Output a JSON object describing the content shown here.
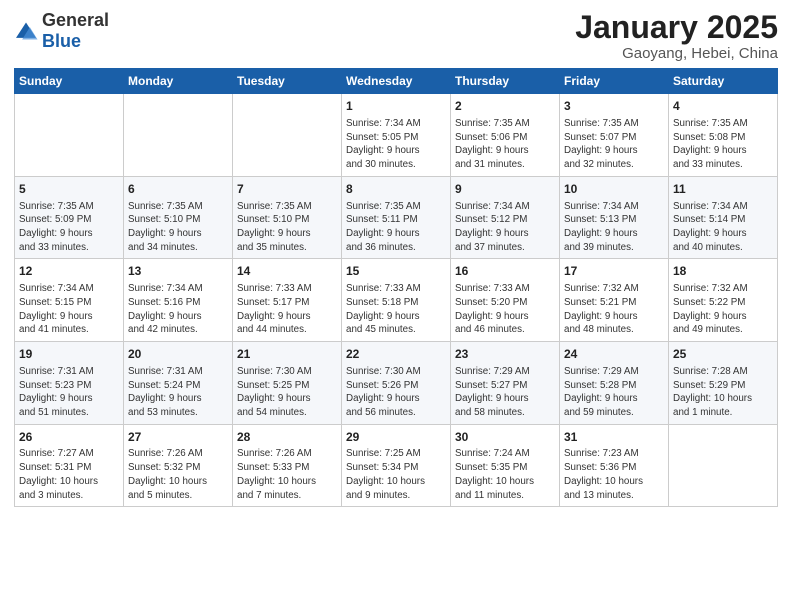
{
  "logo": {
    "general": "General",
    "blue": "Blue"
  },
  "header": {
    "month": "January 2025",
    "location": "Gaoyang, Hebei, China"
  },
  "days_of_week": [
    "Sunday",
    "Monday",
    "Tuesday",
    "Wednesday",
    "Thursday",
    "Friday",
    "Saturday"
  ],
  "weeks": [
    [
      {
        "day": "",
        "info": ""
      },
      {
        "day": "",
        "info": ""
      },
      {
        "day": "",
        "info": ""
      },
      {
        "day": "1",
        "info": "Sunrise: 7:34 AM\nSunset: 5:05 PM\nDaylight: 9 hours\nand 30 minutes."
      },
      {
        "day": "2",
        "info": "Sunrise: 7:35 AM\nSunset: 5:06 PM\nDaylight: 9 hours\nand 31 minutes."
      },
      {
        "day": "3",
        "info": "Sunrise: 7:35 AM\nSunset: 5:07 PM\nDaylight: 9 hours\nand 32 minutes."
      },
      {
        "day": "4",
        "info": "Sunrise: 7:35 AM\nSunset: 5:08 PM\nDaylight: 9 hours\nand 33 minutes."
      }
    ],
    [
      {
        "day": "5",
        "info": "Sunrise: 7:35 AM\nSunset: 5:09 PM\nDaylight: 9 hours\nand 33 minutes."
      },
      {
        "day": "6",
        "info": "Sunrise: 7:35 AM\nSunset: 5:10 PM\nDaylight: 9 hours\nand 34 minutes."
      },
      {
        "day": "7",
        "info": "Sunrise: 7:35 AM\nSunset: 5:10 PM\nDaylight: 9 hours\nand 35 minutes."
      },
      {
        "day": "8",
        "info": "Sunrise: 7:35 AM\nSunset: 5:11 PM\nDaylight: 9 hours\nand 36 minutes."
      },
      {
        "day": "9",
        "info": "Sunrise: 7:34 AM\nSunset: 5:12 PM\nDaylight: 9 hours\nand 37 minutes."
      },
      {
        "day": "10",
        "info": "Sunrise: 7:34 AM\nSunset: 5:13 PM\nDaylight: 9 hours\nand 39 minutes."
      },
      {
        "day": "11",
        "info": "Sunrise: 7:34 AM\nSunset: 5:14 PM\nDaylight: 9 hours\nand 40 minutes."
      }
    ],
    [
      {
        "day": "12",
        "info": "Sunrise: 7:34 AM\nSunset: 5:15 PM\nDaylight: 9 hours\nand 41 minutes."
      },
      {
        "day": "13",
        "info": "Sunrise: 7:34 AM\nSunset: 5:16 PM\nDaylight: 9 hours\nand 42 minutes."
      },
      {
        "day": "14",
        "info": "Sunrise: 7:33 AM\nSunset: 5:17 PM\nDaylight: 9 hours\nand 44 minutes."
      },
      {
        "day": "15",
        "info": "Sunrise: 7:33 AM\nSunset: 5:18 PM\nDaylight: 9 hours\nand 45 minutes."
      },
      {
        "day": "16",
        "info": "Sunrise: 7:33 AM\nSunset: 5:20 PM\nDaylight: 9 hours\nand 46 minutes."
      },
      {
        "day": "17",
        "info": "Sunrise: 7:32 AM\nSunset: 5:21 PM\nDaylight: 9 hours\nand 48 minutes."
      },
      {
        "day": "18",
        "info": "Sunrise: 7:32 AM\nSunset: 5:22 PM\nDaylight: 9 hours\nand 49 minutes."
      }
    ],
    [
      {
        "day": "19",
        "info": "Sunrise: 7:31 AM\nSunset: 5:23 PM\nDaylight: 9 hours\nand 51 minutes."
      },
      {
        "day": "20",
        "info": "Sunrise: 7:31 AM\nSunset: 5:24 PM\nDaylight: 9 hours\nand 53 minutes."
      },
      {
        "day": "21",
        "info": "Sunrise: 7:30 AM\nSunset: 5:25 PM\nDaylight: 9 hours\nand 54 minutes."
      },
      {
        "day": "22",
        "info": "Sunrise: 7:30 AM\nSunset: 5:26 PM\nDaylight: 9 hours\nand 56 minutes."
      },
      {
        "day": "23",
        "info": "Sunrise: 7:29 AM\nSunset: 5:27 PM\nDaylight: 9 hours\nand 58 minutes."
      },
      {
        "day": "24",
        "info": "Sunrise: 7:29 AM\nSunset: 5:28 PM\nDaylight: 9 hours\nand 59 minutes."
      },
      {
        "day": "25",
        "info": "Sunrise: 7:28 AM\nSunset: 5:29 PM\nDaylight: 10 hours\nand 1 minute."
      }
    ],
    [
      {
        "day": "26",
        "info": "Sunrise: 7:27 AM\nSunset: 5:31 PM\nDaylight: 10 hours\nand 3 minutes."
      },
      {
        "day": "27",
        "info": "Sunrise: 7:26 AM\nSunset: 5:32 PM\nDaylight: 10 hours\nand 5 minutes."
      },
      {
        "day": "28",
        "info": "Sunrise: 7:26 AM\nSunset: 5:33 PM\nDaylight: 10 hours\nand 7 minutes."
      },
      {
        "day": "29",
        "info": "Sunrise: 7:25 AM\nSunset: 5:34 PM\nDaylight: 10 hours\nand 9 minutes."
      },
      {
        "day": "30",
        "info": "Sunrise: 7:24 AM\nSunset: 5:35 PM\nDaylight: 10 hours\nand 11 minutes."
      },
      {
        "day": "31",
        "info": "Sunrise: 7:23 AM\nSunset: 5:36 PM\nDaylight: 10 hours\nand 13 minutes."
      },
      {
        "day": "",
        "info": ""
      }
    ]
  ]
}
